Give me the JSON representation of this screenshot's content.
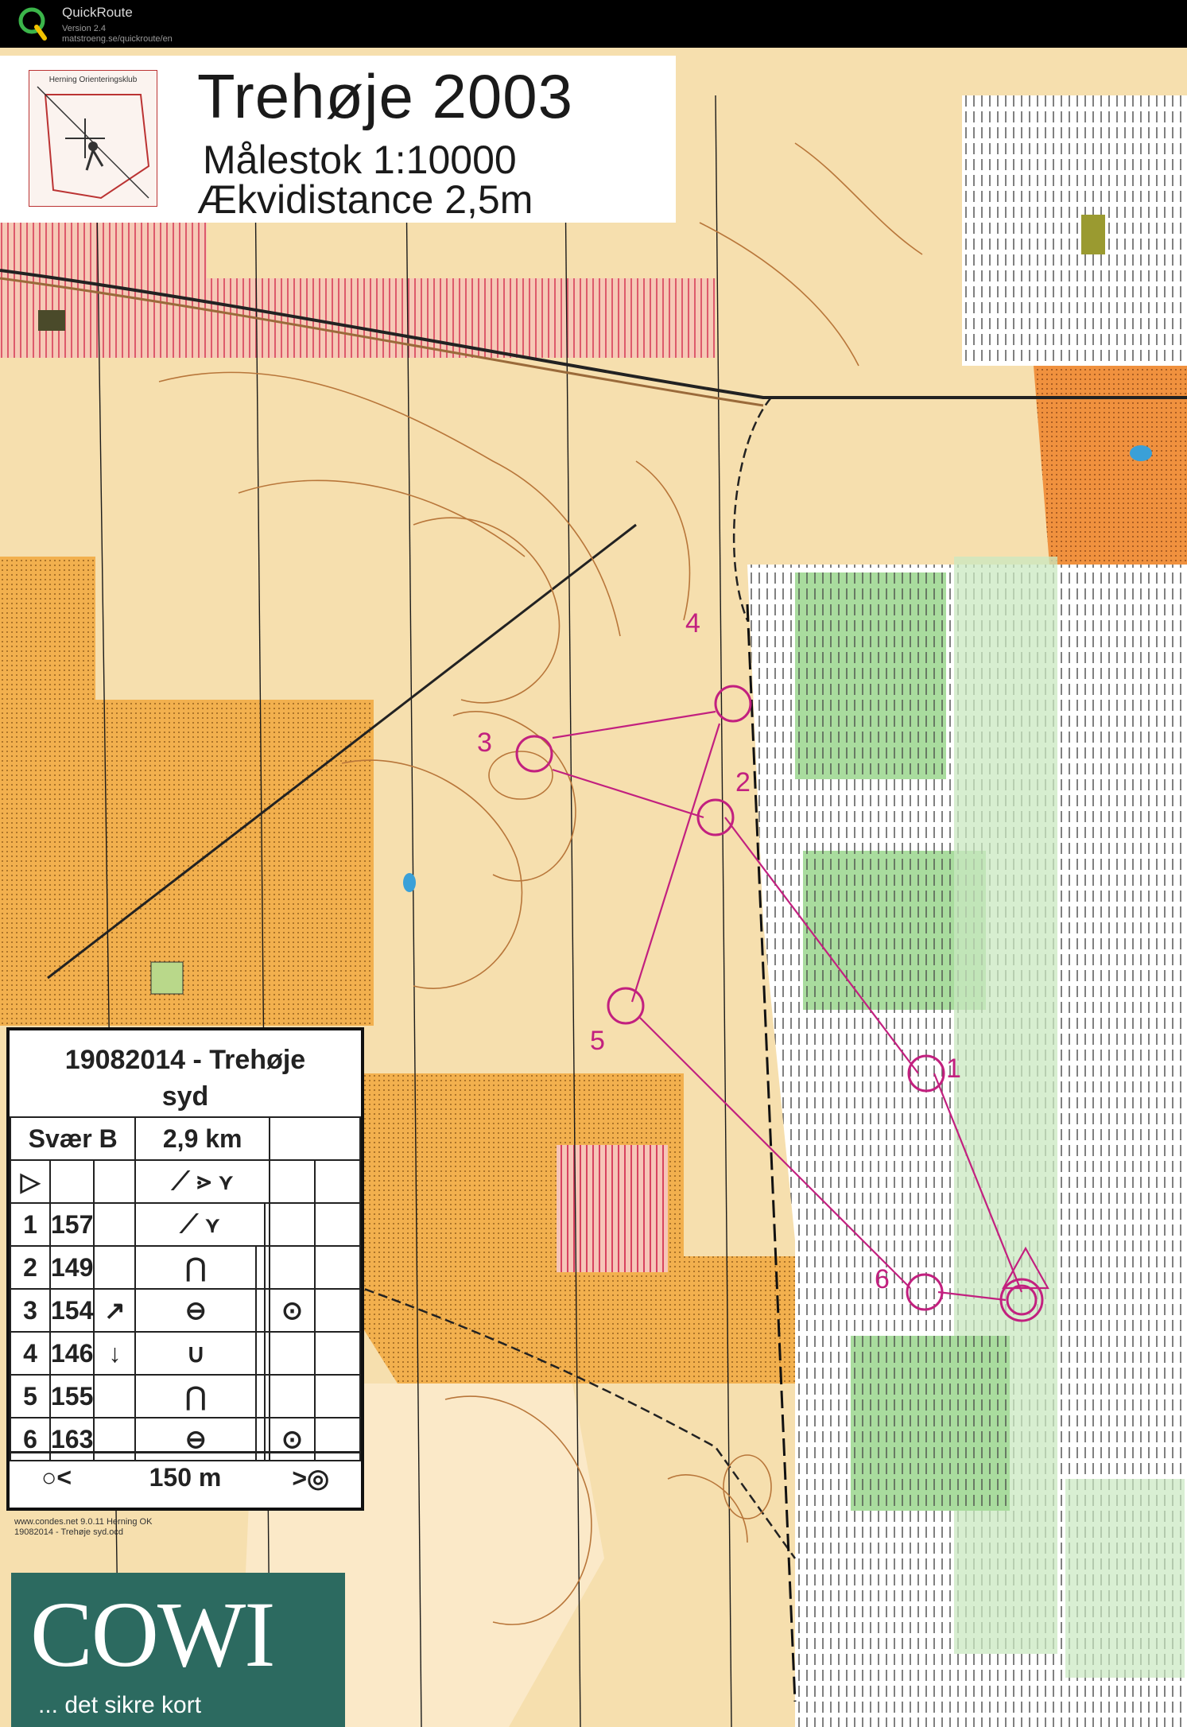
{
  "app": {
    "name": "QuickRoute",
    "version": "Version 2.4",
    "url": "matstroeng.se/quickroute/en"
  },
  "map": {
    "club": "Herning Orienteringsklub",
    "title": "Trehøje 2003",
    "scale": "Målestok 1:10000",
    "contour": "Ækvidistance 2,5m",
    "colors": {
      "open_land": "#f4d9a3",
      "rough_open": "#f2a74a",
      "forest_green": "#3fb04a",
      "light_green": "#b9e2b0",
      "course_magenta": "#c2207f",
      "contour_brown": "#b8763a",
      "restricted_red": "#d8425f"
    }
  },
  "course": {
    "control_labels": [
      "1",
      "2",
      "3",
      "4",
      "5",
      "6"
    ]
  },
  "description": {
    "event_line1": "19082014 - Trehøje",
    "event_line2": "syd",
    "class": "Svær B",
    "length": "2,9 km",
    "start_symbol": "▷",
    "rows": [
      {
        "num": "1",
        "code": "157",
        "dir": "",
        "feature": "⟋ ⋎"
      },
      {
        "num": "2",
        "code": "149",
        "dir": "",
        "feature": "⋂"
      },
      {
        "num": "3",
        "code": "154",
        "dir": "↗",
        "feature": "⊖",
        "extra": "⊙"
      },
      {
        "num": "4",
        "code": "146",
        "dir": "↓",
        "feature": "∪"
      },
      {
        "num": "5",
        "code": "155",
        "dir": "",
        "feature": "⋂"
      },
      {
        "num": "6",
        "code": "163",
        "dir": "",
        "feature": "⊖",
        "extra": "⊙"
      }
    ],
    "start_features": "⟋ ⋗ ⋎",
    "footer_left": "○<",
    "footer_dist": "150 m",
    "footer_right": ">◎"
  },
  "footer": {
    "condes_line1": "www.condes.net 9.0.11 Herning OK",
    "condes_line2": "19082014 - Trehøje syd.ocd"
  },
  "sponsor": {
    "logo": "COWI",
    "tagline": "... det sikre kort"
  }
}
